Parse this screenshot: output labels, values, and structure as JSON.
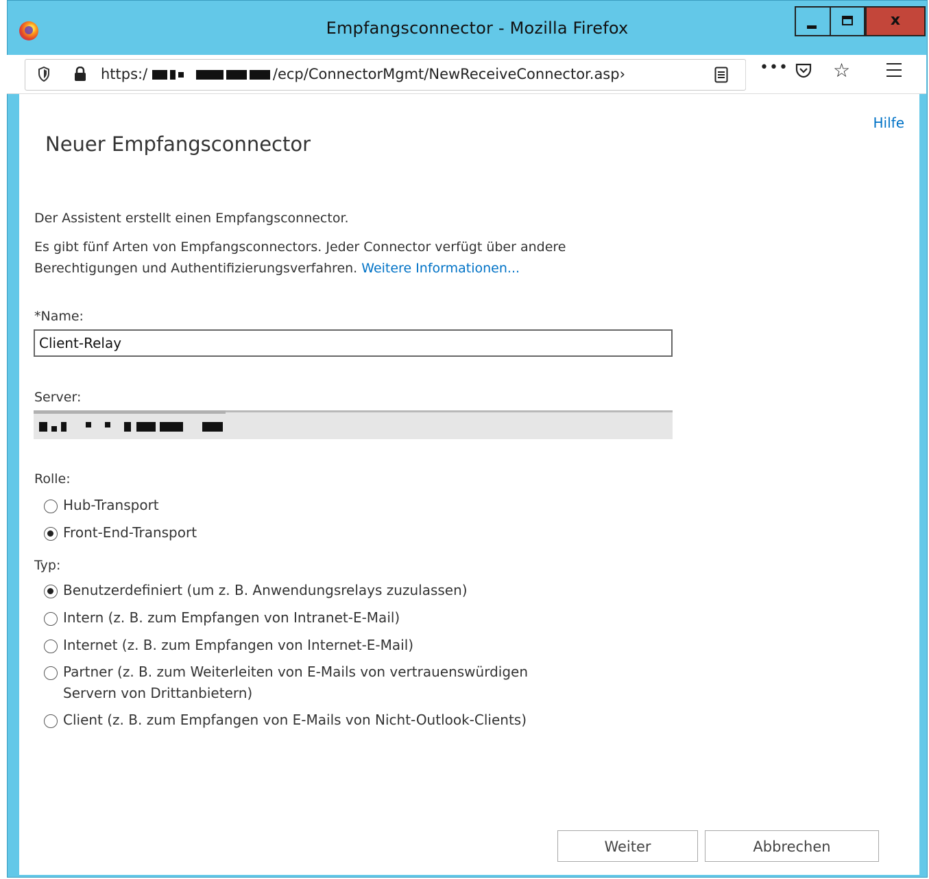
{
  "window": {
    "title": "Empfangsconnector - Mozilla Firefox",
    "close_glyph": "x"
  },
  "browser": {
    "url_prefix": "https:/",
    "url_suffix": "/ecp/ConnectorMgmt/NewReceiveConnector.asp›",
    "more_glyph": "•••",
    "star_glyph": "☆"
  },
  "page": {
    "help_link": "Hilfe",
    "title": "Neuer Empfangsconnector",
    "intro": "Der Assistent erstellt einen Empfangsconnector.",
    "description": "Es gibt fünf Arten von Empfangsconnectors. Jeder Connector verfügt über andere Berechtigungen und Authentifizierungsverfahren.",
    "more_info_link": "Weitere Informationen..."
  },
  "form": {
    "name_label": "*Name:",
    "name_value": "Client-Relay",
    "server_label": "Server:",
    "role_label": "Rolle:",
    "roles": [
      {
        "label": "Hub-Transport",
        "checked": false
      },
      {
        "label": "Front-End-Transport",
        "checked": true
      }
    ],
    "type_label": "Typ:",
    "types": [
      {
        "label": "Benutzerdefiniert (um z. B. Anwendungsrelays zuzulassen)",
        "checked": true
      },
      {
        "label": "Intern (z. B. zum Empfangen von Intranet-E-Mail)",
        "checked": false
      },
      {
        "label": "Internet (z. B. zum Empfangen von Internet-E-Mail)",
        "checked": false
      },
      {
        "label": "Partner (z. B. zum Weiterleiten von E-Mails von vertrauenswürdigen Servern von Drittanbietern)",
        "checked": false
      },
      {
        "label": "Client (z. B. zum Empfangen von E-Mails von Nicht-Outlook-Clients)",
        "checked": false
      }
    ]
  },
  "buttons": {
    "next": "Weiter",
    "cancel": "Abbrechen"
  },
  "colors": {
    "titlebar": "#63c8e8",
    "close_button": "#c3463a",
    "link": "#0072c6"
  }
}
